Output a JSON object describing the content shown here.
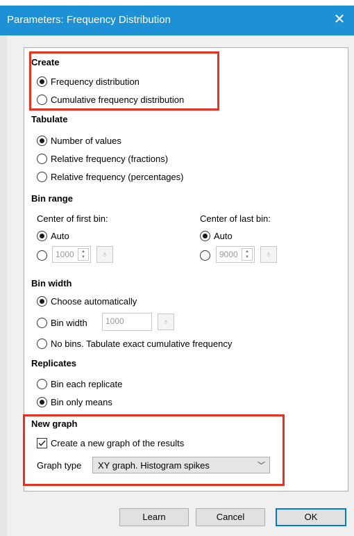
{
  "window": {
    "title": "Parameters: Frequency Distribution",
    "close_glyph": "✕"
  },
  "create": {
    "heading": "Create",
    "options": [
      {
        "label": "Frequency distribution",
        "selected": true
      },
      {
        "label": "Cumulative frequency distribution",
        "selected": false
      }
    ]
  },
  "tabulate": {
    "heading": "Tabulate",
    "options": [
      {
        "label": "Number of values",
        "selected": true
      },
      {
        "label": "Relative frequency (fractions)",
        "selected": false
      },
      {
        "label": "Relative frequency (percentages)",
        "selected": false
      }
    ]
  },
  "bin_range": {
    "heading": "Bin range",
    "first": {
      "label": "Center of first bin:",
      "auto_label": "Auto",
      "value": "1000"
    },
    "last": {
      "label": "Center of last bin:",
      "auto_label": "Auto",
      "value": "9000"
    }
  },
  "bin_width": {
    "heading": "Bin width",
    "auto_label": "Choose automatically",
    "width_label": "Bin width",
    "width_value": "1000",
    "nobins_label": "No bins. Tabulate exact cumulative frequency"
  },
  "replicates": {
    "heading": "Replicates",
    "options": [
      {
        "label": "Bin each replicate",
        "selected": false
      },
      {
        "label": "Bin only means",
        "selected": true
      }
    ]
  },
  "new_graph": {
    "heading": "New graph",
    "checkbox_label": "Create a new graph of the results",
    "checked": true,
    "graph_type_label": "Graph type",
    "graph_type_value": "XY graph. Histogram spikes"
  },
  "buttons": {
    "learn": "Learn",
    "cancel": "Cancel",
    "ok": "OK"
  },
  "colors": {
    "titlebar": "#1e90d6",
    "highlight": "#e8321e"
  }
}
